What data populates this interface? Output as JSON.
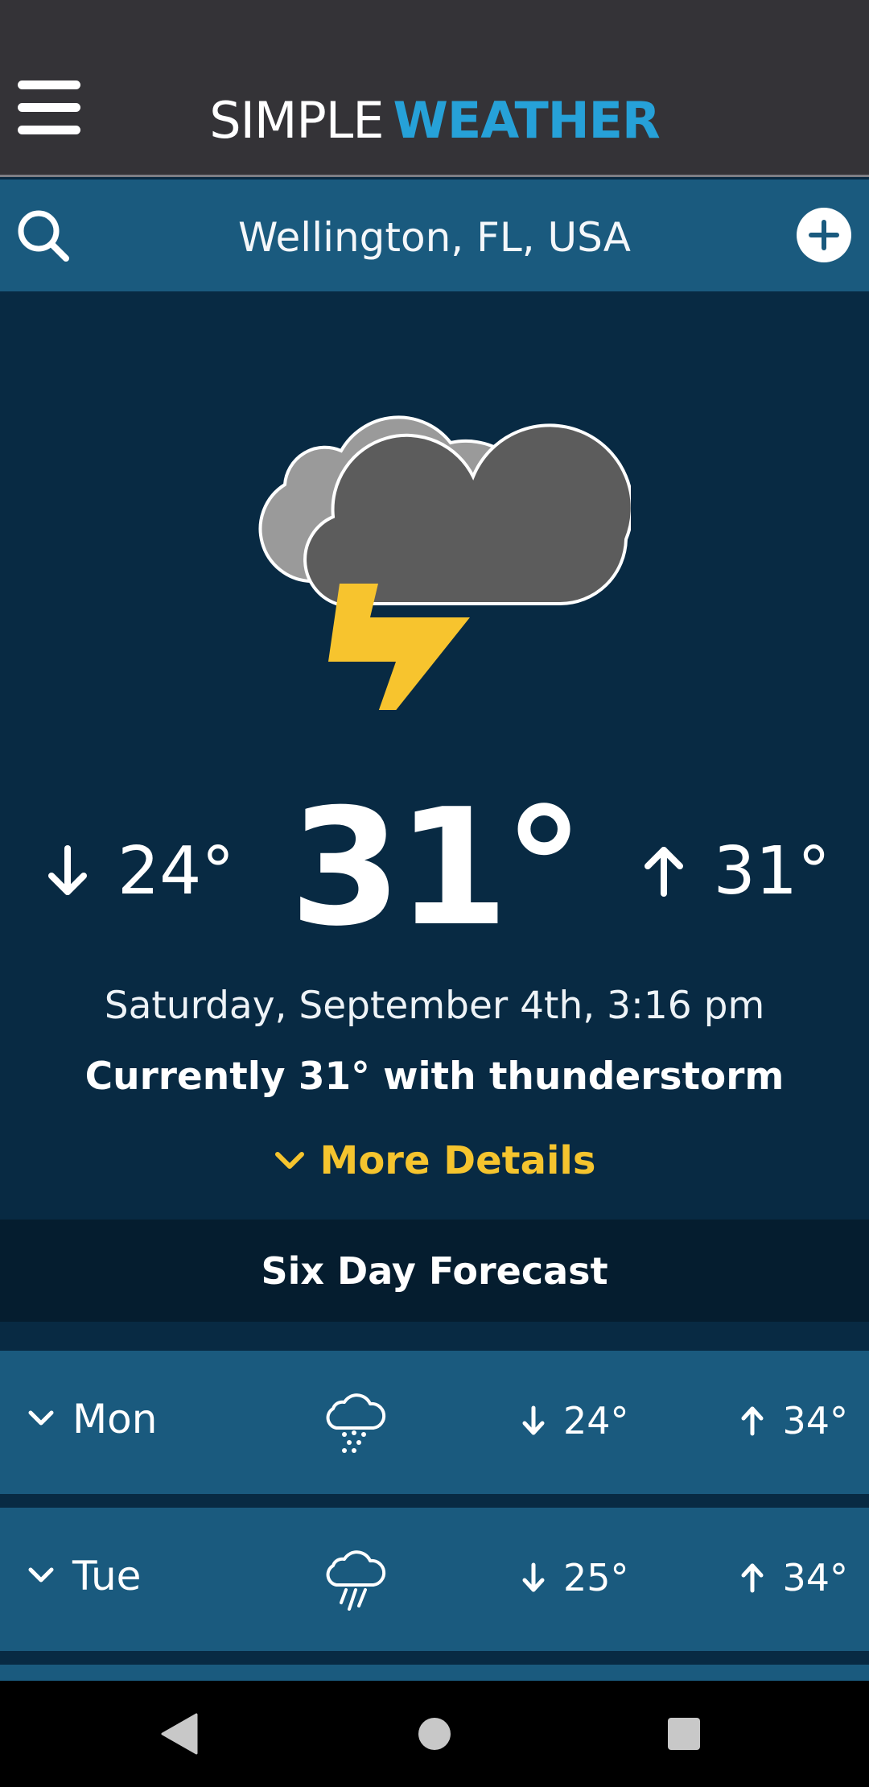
{
  "app": {
    "title_light": "SIMPLE",
    "title_bold": "WEATHER",
    "accent_color": "#26a1d8"
  },
  "search": {
    "location": "Wellington, FL, USA"
  },
  "current": {
    "condition_icon": "thunderstorm-icon",
    "low": "24°",
    "temperature": "31°",
    "high": "31°",
    "datetime": "Saturday, September 4th, 3:16 pm",
    "summary": "Currently 31° with thunderstorm",
    "more_details_label": "More Details"
  },
  "forecast": {
    "heading": "Six Day Forecast",
    "days": [
      {
        "day": "Mon",
        "icon": "drizzle-icon",
        "low": "24°",
        "high": "34°"
      },
      {
        "day": "Tue",
        "icon": "rain-icon",
        "low": "25°",
        "high": "34°"
      }
    ]
  },
  "colors": {
    "app_bar": "#343337",
    "search_bar": "#1a5a7e",
    "hero_bg": "#082a43",
    "forecast_header": "#051d2f",
    "details_accent": "#f5c42e",
    "bolt": "#f7c42e"
  }
}
